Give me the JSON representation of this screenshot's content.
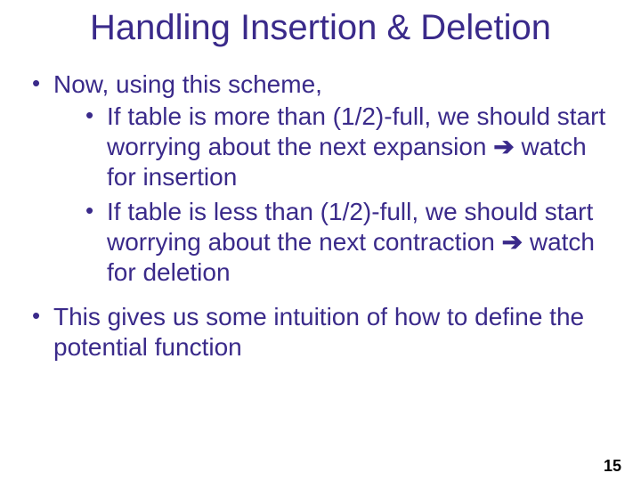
{
  "title": "Handling Insertion & Deletion",
  "bullets": {
    "b1": "Now, using this scheme,",
    "b1a_pre": "If table is more than (1/2)-full, we should start worrying about the next expansion ",
    "b1a_post": " watch for insertion",
    "b1b_pre": "If table is less than (1/2)-full, we should start worrying about the next contraction ",
    "b1b_post": " watch for deletion",
    "b2": "This gives us some intuition of how to define the potential function"
  },
  "arrow": "➔",
  "page_number": "15"
}
